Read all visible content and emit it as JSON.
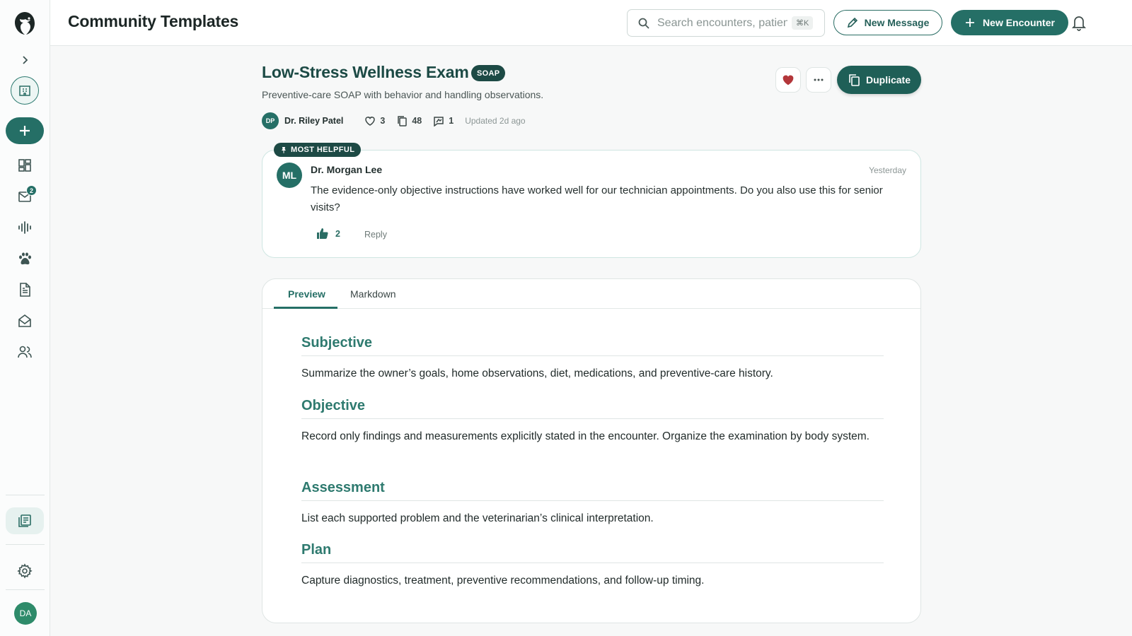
{
  "sidebar": {
    "icons": [
      "logo",
      "expand-chevron",
      "clinic",
      "new",
      "dashboard",
      "inbox",
      "audio",
      "patients",
      "documents",
      "mail",
      "team",
      "templates",
      "settings"
    ],
    "inbox_badge": "2",
    "user_initials": "DA"
  },
  "header": {
    "title": "Community Templates",
    "search_placeholder": "Search encounters, patients",
    "search_shortcut": "⌘K",
    "new_message_label": "New Message",
    "new_encounter_label": "New Encounter"
  },
  "template": {
    "title": "Low-Stress Wellness Exam",
    "tag": "SOAP",
    "description": "Preventive-care SOAP with behavior and handling observations.",
    "author_initials": "DP",
    "author_name": "Dr. Riley Patel",
    "likes": "3",
    "copies": "48",
    "comments": "1",
    "updated": "Updated 2d ago",
    "duplicate_label": "Duplicate",
    "favorited": true
  },
  "comment": {
    "badge": "MOST HELPFUL",
    "author_initials": "ML",
    "author": "Dr. Morgan Lee",
    "time": "Yesterday",
    "body": "The evidence-only objective instructions have worked well for our technician appointments. Do you also use this for senior visits?",
    "likes": "2",
    "reply_label": "Reply"
  },
  "preview": {
    "tabs": [
      {
        "label": "Preview",
        "active": true
      },
      {
        "label": "Markdown",
        "active": false
      }
    ],
    "sections": [
      {
        "title": "Subjective",
        "body": "Summarize the owner’s goals, home observations, diet, medications, and preventive-care history."
      },
      {
        "title": "Objective",
        "body": "Record only findings and measurements explicitly stated in the encounter. Organize the examination by body system."
      },
      {
        "title": "Assessment",
        "body": "List each supported problem and the veterinarian’s clinical interpretation."
      },
      {
        "title": "Plan",
        "body": "Capture diagnostics, treatment, preventive recommendations, and follow-up timing."
      }
    ]
  },
  "colors": {
    "brand": "#256f66",
    "brand_dark": "#1d4a45",
    "heading": "#2e7a6f",
    "favorite": "#b3363a"
  }
}
